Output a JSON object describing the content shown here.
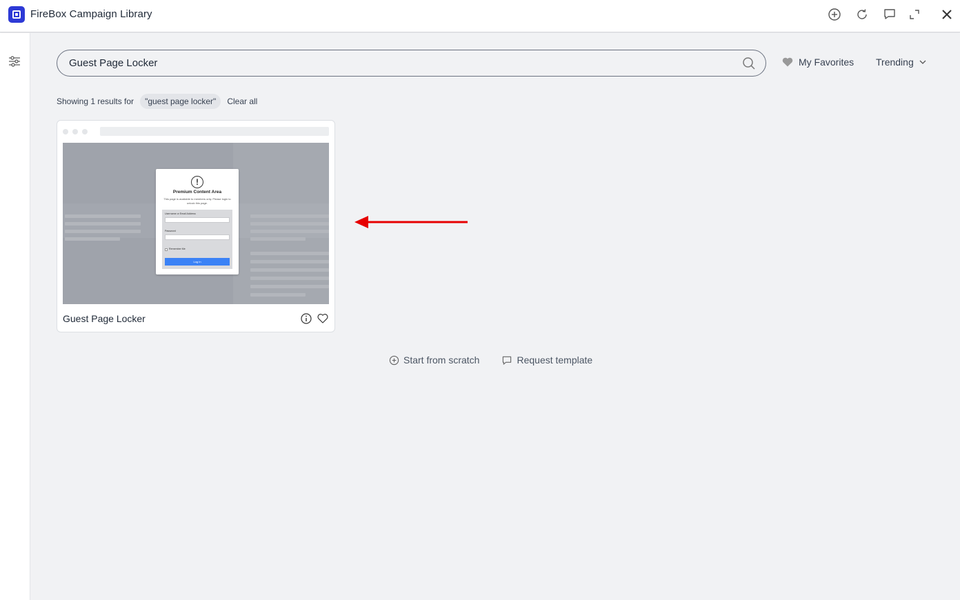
{
  "window": {
    "title": "FireBox Campaign Library",
    "toolbar_icons": [
      "add-circle-icon",
      "refresh-icon",
      "comment-icon",
      "expand-icon",
      "close-icon"
    ]
  },
  "sidebar": {
    "icons": [
      "filter-sliders-icon"
    ]
  },
  "search": {
    "value": "Guest Page Locker",
    "placeholder": ""
  },
  "header_links": {
    "favorites_label": "My Favorites",
    "sort_label": "Trending"
  },
  "results": {
    "prefix": "Showing 1 results for",
    "query": "\"guest page locker\"",
    "clear_label": "Clear all"
  },
  "templates": [
    {
      "name": "Guest Page Locker",
      "preview": {
        "heading": "Premium Content Area",
        "subtext": "This page is available to members only. Please login to unlock this page.",
        "username_label": "Username or Email Address",
        "password_label": "Password",
        "remember_label": "Remember Me",
        "button_label": "Log In"
      }
    }
  ],
  "actions": {
    "start_label": "Start from scratch",
    "request_label": "Request template"
  },
  "colors": {
    "brand": "#2d3ad6",
    "annotation_arrow": "#e60000",
    "preview_button": "#3b82f6"
  }
}
